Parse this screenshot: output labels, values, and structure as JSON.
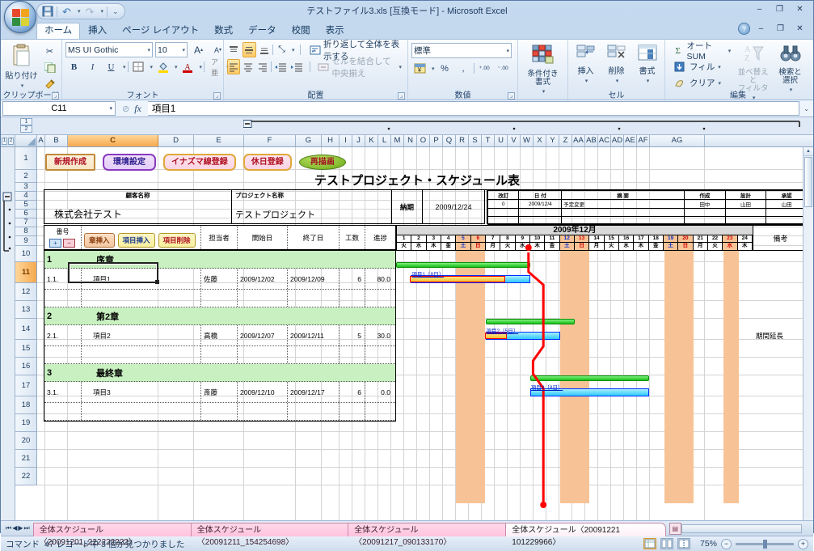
{
  "window": {
    "title": "テストファイル3.xls [互換モード] - Microsoft Excel",
    "minimize": "‒",
    "maximize": "❐",
    "close": "✕",
    "help": "?"
  },
  "quick_access": {
    "save": "save-icon",
    "undo": "↶",
    "redo": "↷",
    "more": "▾"
  },
  "ribbon_tabs": [
    {
      "label": "ホーム",
      "active": true
    },
    {
      "label": "挿入",
      "active": false
    },
    {
      "label": "ページ レイアウト",
      "active": false
    },
    {
      "label": "数式",
      "active": false
    },
    {
      "label": "データ",
      "active": false
    },
    {
      "label": "校閲",
      "active": false
    },
    {
      "label": "表示",
      "active": false
    }
  ],
  "ribbon": {
    "clipboard": {
      "label": "クリップボード",
      "paste": "貼り付け",
      "cut": "cut-icon",
      "copy": "copy-icon",
      "format_painter": "format-painter-icon"
    },
    "font": {
      "label": "フォント",
      "font_name": "MS UI Gothic",
      "font_size": "10",
      "grow": "A",
      "shrink": "A",
      "bold": "B",
      "italic": "I",
      "underline": "U",
      "borders": "borders-icon",
      "fill": "fill-color-icon",
      "fontcolor": "font-color-icon",
      "phonetic": "phonetic-icon"
    },
    "alignment": {
      "label": "配置",
      "wrap_text": "折り返して全体を表示する",
      "merge_center": "セルを結合して中央揃え",
      "orientation": "orientation-icon",
      "indent_dec": "indent-decrease-icon",
      "indent_inc": "indent-increase-icon"
    },
    "number": {
      "label": "数値",
      "format": "標準",
      "currency": "currency-icon",
      "percent": "%",
      "comma": ",",
      "inc_dec": "increase-decimal-icon",
      "dec_dec": "decrease-decimal-icon"
    },
    "styles": {
      "label": "",
      "conditional": "条件付き\n書式"
    },
    "cells": {
      "label": "セル",
      "insert": "挿入",
      "delete": "削除",
      "format": "書式"
    },
    "editing": {
      "label": "編集",
      "autosum": "オート SUM",
      "fill": "フィル",
      "clear": "クリア",
      "sort_filter": "並べ替えと\nフィルタ",
      "find_select": "検索と\n選択"
    }
  },
  "formula_bar": {
    "name_box": "C11",
    "fx": "fx",
    "value": "項目1",
    "cancel": "cancel-icon"
  },
  "outline": {
    "level1": "1",
    "level2": "2",
    "col_levels": [
      "1",
      "2"
    ]
  },
  "columns": [
    "A",
    "B",
    "C",
    "D",
    "E",
    "F",
    "G",
    "H",
    "I",
    "J",
    "K",
    "L",
    "M",
    "N",
    "O",
    "P",
    "Q",
    "R",
    "S",
    "T",
    "U",
    "V",
    "W",
    "X",
    "Y",
    "Z",
    "AA",
    "AB",
    "AC",
    "AD",
    "AE",
    "AF",
    "AG"
  ],
  "selected_column": "C",
  "rows": [
    1,
    2,
    3,
    4,
    5,
    6,
    7,
    8,
    9,
    10,
    11,
    12,
    13,
    14,
    15,
    16,
    17,
    18,
    19,
    20,
    21,
    22
  ],
  "selected_row": 11,
  "toolbar_buttons": [
    {
      "label": "新規作成",
      "style": "scroll"
    },
    {
      "label": "環境設定",
      "style": "purple"
    },
    {
      "label": "イナズマ線登録",
      "style": "pink"
    },
    {
      "label": "休日登録",
      "style": "pink"
    },
    {
      "label": "再描画",
      "style": "green-ellipse"
    }
  ],
  "document": {
    "title": "テストプロジェクト・スケジュール表",
    "customer_label": "顧客名称",
    "customer_value": "株式会社テスト",
    "project_label": "プロジェクト名称",
    "project_value": "テストプロジェクト",
    "deadline_label": "納期",
    "deadline_value": "2009/12/24",
    "revision_table": {
      "headers": [
        "改訂",
        "日 付",
        "摘  要",
        "作成",
        "設計",
        "承認"
      ],
      "rows": [
        [
          "0",
          "2009/12/4",
          "予定変更",
          "田中",
          "山田",
          "山田"
        ],
        [
          "",
          "",
          "",
          "",
          "",
          ""
        ],
        [
          "",
          "",
          "",
          "",
          "",
          ""
        ]
      ]
    },
    "table_headers": {
      "number": "番号",
      "plus": "+",
      "minus": "−",
      "insert_chapter": "章挿入",
      "insert_item": "項目挿入",
      "delete_item": "項目削除",
      "owner": "担当者",
      "start": "開始日",
      "end": "終了日",
      "effort": "工数",
      "progress": "進捗",
      "remarks": "備考"
    },
    "gantt_header": {
      "month": "2009年12月",
      "days": [
        1,
        2,
        3,
        4,
        5,
        6,
        7,
        8,
        9,
        10,
        11,
        12,
        13,
        14,
        15,
        16,
        17,
        18,
        19,
        20,
        21,
        22,
        23,
        24
      ],
      "weekdays": [
        "火",
        "水",
        "木",
        "金",
        "土",
        "日",
        "月",
        "火",
        "水",
        "木",
        "金",
        "土",
        "日",
        "月",
        "火",
        "水",
        "木",
        "金",
        "土",
        "日",
        "月",
        "火",
        "水",
        "木"
      ],
      "weekend_sat": [
        5,
        12,
        19
      ],
      "weekend_sun": [
        6,
        13,
        20
      ],
      "holiday": [
        23
      ]
    },
    "task_rows": [
      {
        "type": "chapter",
        "no": "1",
        "name": "序章",
        "owner": "",
        "start": "",
        "end": "",
        "effort": "",
        "progress": "",
        "remarks": ""
      },
      {
        "type": "task",
        "no": "1.1.",
        "name": "項目1",
        "owner": "佐藤",
        "start": "2009/12/02",
        "end": "2009/12/09",
        "effort": "6",
        "progress": "80.0",
        "remarks": "",
        "bar_label": "項目1〔8日〕",
        "bar_start_day": 2,
        "bar_end_day": 9,
        "plan_start_day": 1,
        "plan_end_day": 9,
        "progress_pct": 80
      },
      {
        "type": "blank",
        "no": "",
        "name": "",
        "owner": "",
        "start": "",
        "end": "",
        "effort": "",
        "progress": "",
        "remarks": ""
      },
      {
        "type": "chapter",
        "no": "2",
        "name": "第2章",
        "owner": "",
        "start": "",
        "end": "",
        "effort": "",
        "progress": "",
        "remarks": ""
      },
      {
        "type": "task",
        "no": "2.1.",
        "name": "項目2",
        "owner": "高橋",
        "start": "2009/12/07",
        "end": "2009/12/11",
        "effort": "5",
        "progress": "30.0",
        "remarks": "期間延長",
        "bar_label": "項目2〔5日〕",
        "bar_start_day": 7,
        "bar_end_day": 11,
        "plan_start_day": 7,
        "plan_end_day": 12,
        "progress_pct": 30
      },
      {
        "type": "blank",
        "no": "",
        "name": "",
        "owner": "",
        "start": "",
        "end": "",
        "effort": "",
        "progress": "",
        "remarks": ""
      },
      {
        "type": "chapter",
        "no": "3",
        "name": "最終章",
        "owner": "",
        "start": "",
        "end": "",
        "effort": "",
        "progress": "",
        "remarks": ""
      },
      {
        "type": "task",
        "no": "3.1.",
        "name": "項目3",
        "owner": "斎藤",
        "start": "2009/12/10",
        "end": "2009/12/17",
        "effort": "6",
        "progress": "0.0",
        "remarks": "",
        "bar_label": "項目3〔8日〕",
        "bar_start_day": 10,
        "bar_end_day": 17,
        "plan_start_day": 10,
        "plan_end_day": 17,
        "progress_pct": 0
      },
      {
        "type": "blank",
        "no": "",
        "name": "",
        "owner": "",
        "start": "",
        "end": "",
        "effort": "",
        "progress": "",
        "remarks": ""
      }
    ]
  },
  "sheet_tabs": [
    {
      "label": "全体スケジュール〈20091201_222222222〉",
      "active": false
    },
    {
      "label": "全体スケジュール〈20091211_154254698〉",
      "active": false
    },
    {
      "label": "全体スケジュール〈20091217_090133170〉",
      "active": false
    },
    {
      "label": "全体スケジュール〈20091221 101229966〉",
      "active": true
    }
  ],
  "sheet_nav": {
    "first": "⏮",
    "prev": "◀",
    "next": "▶",
    "last": "⏭",
    "new": "new-sheet-icon"
  },
  "status": {
    "mode": "コマンド",
    "message": "47 レコード中 3 個が見つかりました",
    "zoom": "75%",
    "zoom_out": "−",
    "zoom_in": "+",
    "view_normal": "normal-view-icon",
    "view_layout": "page-layout-icon",
    "view_break": "page-break-icon"
  },
  "colors": {
    "chapter_row": "#c8f0c0",
    "weekend": "#f7c396",
    "plan_bar": "#22cc22",
    "actual_bar": "#33ccff",
    "progress_bar": "#ffcc33",
    "today_line": "#ff0000"
  }
}
